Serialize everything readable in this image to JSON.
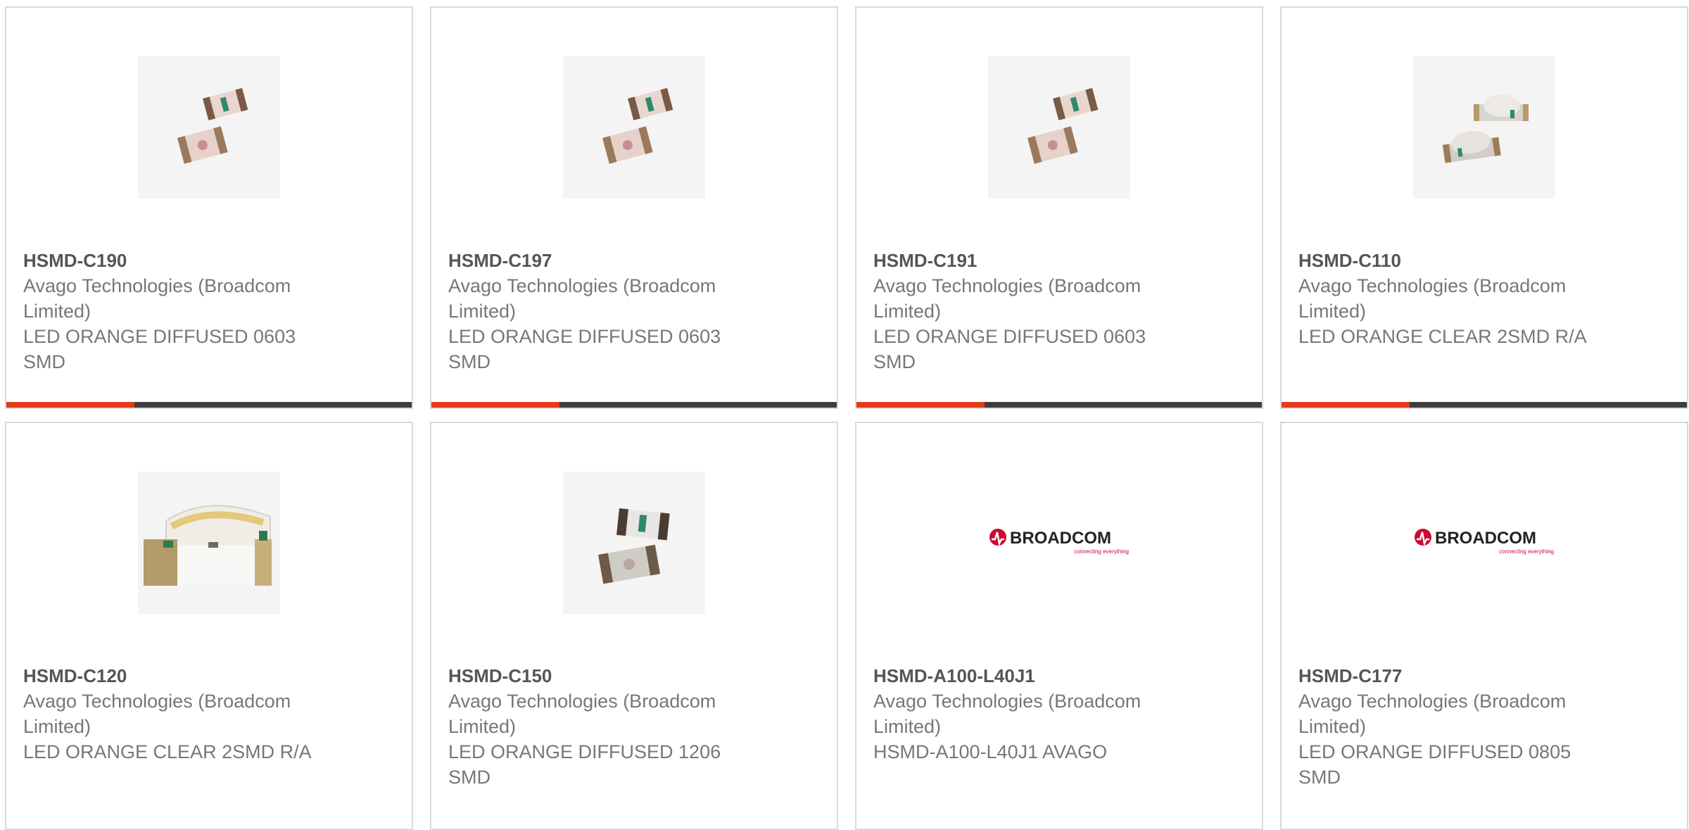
{
  "colors": {
    "accent": "#e4391b",
    "bar": "#3d3d3d",
    "border": "#d9d9d9",
    "part_text": "#555555",
    "body_text": "#777777",
    "broadcom_red": "#cc092f"
  },
  "products": [
    {
      "part": "HSMD-C190",
      "manufacturer": "Avago Technologies (Broadcom Limited)",
      "description": "LED ORANGE DIFFUSED 0603 SMD",
      "image": "led-0603-smd-photo"
    },
    {
      "part": "HSMD-C197",
      "manufacturer": "Avago Technologies (Broadcom Limited)",
      "description": "LED ORANGE DIFFUSED 0603 SMD",
      "image": "led-0603-smd-photo"
    },
    {
      "part": "HSMD-C191",
      "manufacturer": "Avago Technologies (Broadcom Limited)",
      "description": "LED ORANGE DIFFUSED 0603 SMD",
      "image": "led-0603-smd-photo"
    },
    {
      "part": "HSMD-C110",
      "manufacturer": "Avago Technologies (Broadcom Limited)",
      "description": "LED ORANGE CLEAR 2SMD R/A",
      "image": "led-right-angle-photo"
    },
    {
      "part": "HSMD-C120",
      "manufacturer": "Avago Technologies (Broadcom Limited)",
      "description": "LED ORANGE CLEAR 2SMD R/A",
      "image": "led-right-angle-large-photo"
    },
    {
      "part": "HSMD-C150",
      "manufacturer": "Avago Technologies (Broadcom Limited)",
      "description": "LED ORANGE DIFFUSED 1206 SMD",
      "image": "led-1206-smd-photo"
    },
    {
      "part": "HSMD-A100-L40J1",
      "manufacturer": "Avago Technologies (Broadcom Limited)",
      "description": "HSMD-A100-L40J1 AVAGO",
      "image": "broadcom-logo"
    },
    {
      "part": "HSMD-C177",
      "manufacturer": "Avago Technologies (Broadcom Limited)",
      "description": "LED ORANGE DIFFUSED 0805 SMD",
      "image": "broadcom-logo"
    }
  ],
  "logo": {
    "wordmark": "BROADCOM",
    "tagline": "connecting everything"
  }
}
